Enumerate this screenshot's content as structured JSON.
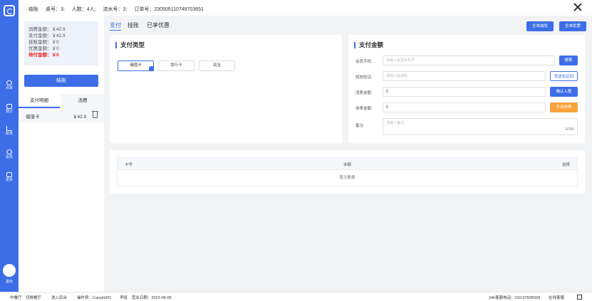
{
  "nav": {
    "items": [
      {
        "label": "点单",
        "icon": "dish-icon"
      },
      {
        "label": "预订",
        "icon": "calendar-icon"
      },
      {
        "label": "账单",
        "icon": "chart-icon"
      },
      {
        "label": "会员",
        "icon": "member-icon"
      },
      {
        "label": "更多",
        "icon": "grid-icon"
      }
    ],
    "logout": "退出"
  },
  "topbar": {
    "mode": "结账",
    "table": "桌号：3;",
    "people": "人数：4人;",
    "serial": "流水号：3;",
    "order": "订单号：230505110749703651"
  },
  "summary": {
    "consume": "消费金额：￥42.9",
    "pay": "支付金额：￥42.9",
    "hang": "挂账金额：￥0",
    "discount": "优惠金额：￥0",
    "pending": "待付金额：￥0"
  },
  "settle_label": "结账",
  "left_tabs": {
    "tab1": "支付明细",
    "tab2": "消费"
  },
  "payment_row": {
    "name": "储值卡",
    "amount": "￥42.9"
  },
  "main_tabs": {
    "pay": "支付",
    "hang": "挂账",
    "used": "已享优惠"
  },
  "actions": {
    "whole_reduce": "全单减免",
    "whole_discount": "全单优惠"
  },
  "pay_type": {
    "title": "支付类型",
    "options": [
      "储值卡",
      "银行卡",
      "现金"
    ]
  },
  "pay_amount": {
    "title": "支付金额",
    "phone_label": "会员手机:",
    "phone_placeholder": "请输入会员手机号",
    "search_btn": "搜索",
    "sms_label": "短信验证:",
    "sms_placeholder": "请输入验证码",
    "sms_btn": "发送验证码",
    "consume_label": "消费金额:",
    "consume_value": "0",
    "confirm_btn": "确认入账",
    "round_label": "抹零金额:",
    "round_value": "0",
    "round_btn": "手动抹零",
    "note_label": "备注:",
    "note_placeholder": "请输入备注",
    "note_counter": "0/150"
  },
  "table": {
    "col_card": "卡号",
    "col_balance": "余额",
    "col_select": "选择",
    "empty": "暂无数据"
  },
  "statusbar": {
    "restaurant": "中餐厅",
    "switch": "切换餐厅",
    "backend": "进入后台",
    "operator": "操作员：Canyin001",
    "shift": "早班",
    "date": "营业日期：2023-05-05",
    "hotline": "24h客服电话：010-57835508",
    "online": "在线客服"
  },
  "colors": {
    "primary": "#3d6ee8",
    "warning": "#f7a23b",
    "danger": "#ee2424"
  }
}
